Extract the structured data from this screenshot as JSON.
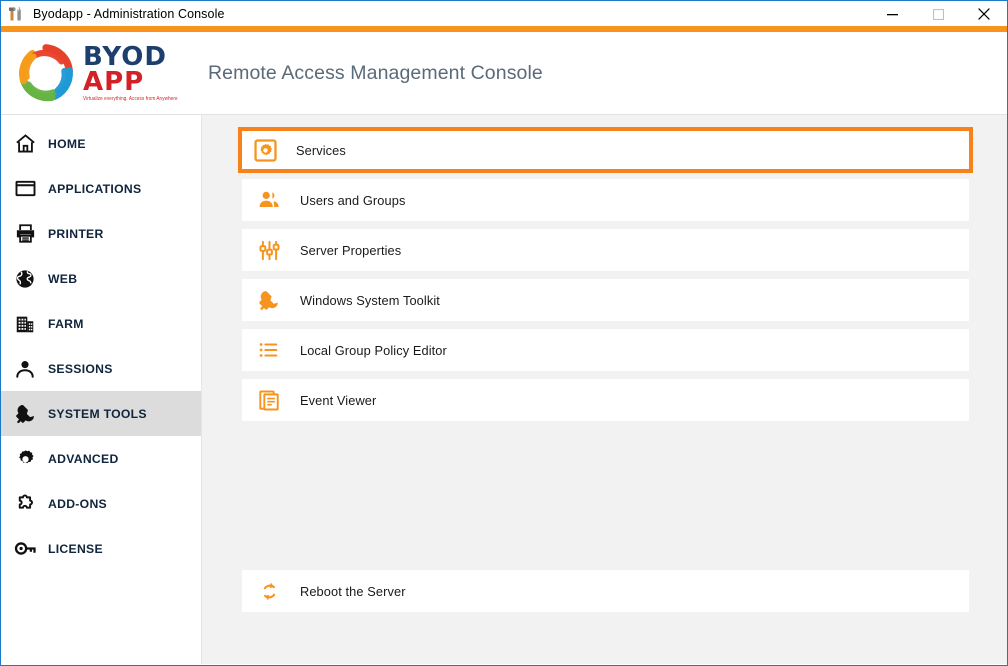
{
  "window": {
    "title": "Byodapp - Administration Console",
    "title_icon": "tools-hammer-wrench-icon",
    "controls": {
      "minimize": "minimize-icon",
      "maximize": "maximize-icon",
      "close": "close-icon"
    },
    "accent_color": "#f7941e",
    "border_color": "#1a79c8"
  },
  "header": {
    "logo": {
      "brand_top": "BYOD",
      "brand_bottom": "APP",
      "tagline": "Virtualize everything. Access from Anywhere",
      "brand_top_color": "#1c3f6e",
      "brand_bottom_color": "#d42027"
    },
    "console_title": "Remote Access Management Console"
  },
  "sidebar": {
    "active_index": 6,
    "items": [
      {
        "label": "HOME",
        "icon": "home-icon"
      },
      {
        "label": "APPLICATIONS",
        "icon": "window-icon"
      },
      {
        "label": "PRINTER",
        "icon": "printer-icon"
      },
      {
        "label": "WEB",
        "icon": "globe-icon"
      },
      {
        "label": "FARM",
        "icon": "building-icon"
      },
      {
        "label": "SESSIONS",
        "icon": "user-icon"
      },
      {
        "label": "SYSTEM TOOLS",
        "icon": "wrench-icon"
      },
      {
        "label": "ADVANCED",
        "icon": "gear-icon"
      },
      {
        "label": "ADD-ONS",
        "icon": "puzzle-piece-icon"
      },
      {
        "label": "LICENSE",
        "icon": "key-icon"
      }
    ]
  },
  "main": {
    "highlight_color": "#f7821b",
    "icon_color": "#f7941e",
    "tools": [
      {
        "label": "Services",
        "icon": "services-gear-box-icon",
        "highlighted": true
      },
      {
        "label": "Users and Groups",
        "icon": "users-group-icon",
        "highlighted": false
      },
      {
        "label": "Server Properties",
        "icon": "sliders-icon",
        "highlighted": false
      },
      {
        "label": "Windows System Toolkit",
        "icon": "wrench-icon",
        "highlighted": false
      },
      {
        "label": "Local Group Policy Editor",
        "icon": "list-icon",
        "highlighted": false
      },
      {
        "label": "Event Viewer",
        "icon": "documents-stack-icon",
        "highlighted": false
      }
    ],
    "reboot": {
      "label": "Reboot the Server",
      "icon": "refresh-sync-icon"
    }
  }
}
